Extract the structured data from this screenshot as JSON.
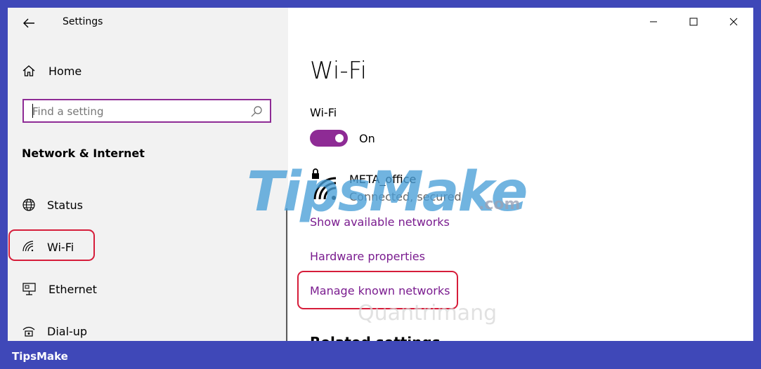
{
  "window": {
    "app_title": "Settings",
    "controls": {
      "minimize_icon": "minimize-icon",
      "maximize_icon": "maximize-icon",
      "close_icon": "close-icon"
    }
  },
  "sidebar": {
    "home_label": "Home",
    "search_placeholder": "Find a setting",
    "section_title": "Network & Internet",
    "items": [
      {
        "label": "Status",
        "icon": "globe-icon"
      },
      {
        "label": "Wi-Fi",
        "icon": "wifi-icon"
      },
      {
        "label": "Ethernet",
        "icon": "ethernet-icon"
      },
      {
        "label": "Dial-up",
        "icon": "dialup-icon"
      }
    ]
  },
  "main": {
    "page_title": "Wi-Fi",
    "wifi_label": "Wi-Fi",
    "toggle_state": "On",
    "network": {
      "name": "META_office",
      "status": "Connected, secured"
    },
    "links": {
      "show_available": "Show available networks",
      "hardware_properties": "Hardware properties",
      "manage_known": "Manage known networks"
    },
    "partial_heading": "Related settings"
  },
  "watermarks": {
    "main": "TipsMake",
    "domain": ".com",
    "secondary": "Quantrimang"
  },
  "footer": {
    "brand": "TipsMake"
  },
  "colors": {
    "accent": "#8e2b95",
    "link": "#7a1c8f",
    "highlight": "#d61d3a",
    "frame": "#3f48b8"
  }
}
